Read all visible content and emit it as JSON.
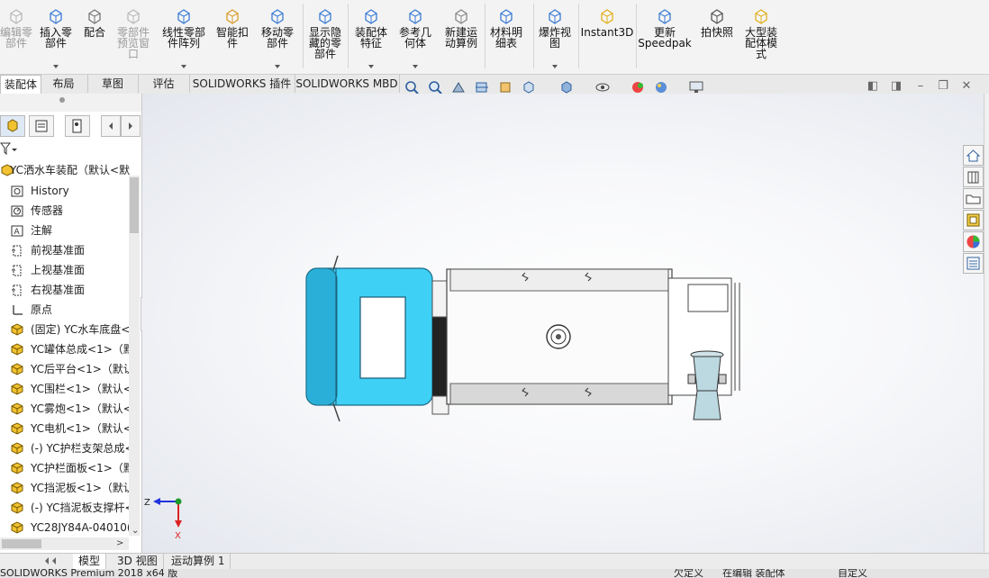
{
  "ribbon": {
    "commands": [
      {
        "id": "edit-component",
        "label": "编辑零\n部件",
        "disabled": true
      },
      {
        "id": "insert-component",
        "label": "插入零\n部件",
        "disabled": false,
        "dropdown": true
      },
      {
        "id": "mate",
        "label": "配合",
        "disabled": false
      },
      {
        "id": "component-preview",
        "label": "零部件\n预览窗\n口",
        "disabled": true
      },
      {
        "id": "linear-pattern",
        "label": "线性零部\n件阵列",
        "disabled": false,
        "dropdown": true
      },
      {
        "id": "smart-fasteners",
        "label": "智能扣\n件",
        "disabled": false
      },
      {
        "id": "move-component",
        "label": "移动零\n部件",
        "disabled": false,
        "dropdown": true
      },
      {
        "id": "show-hidden",
        "label": "显示隐\n藏的零\n部件",
        "disabled": false
      },
      {
        "id": "assembly-features",
        "label": "装配体\n特征",
        "disabled": false,
        "dropdown": true
      },
      {
        "id": "reference-geometry",
        "label": "参考几\n何体",
        "disabled": false,
        "dropdown": true
      },
      {
        "id": "new-motion-study",
        "label": "新建运\n动算例",
        "disabled": false
      },
      {
        "id": "bill-of-materials",
        "label": "材料明\n细表",
        "disabled": false
      },
      {
        "id": "exploded-view",
        "label": "爆炸视\n图",
        "disabled": false,
        "dropdown": true
      },
      {
        "id": "instant3d",
        "label": "Instant3D",
        "disabled": false
      },
      {
        "id": "update-speedpak",
        "label": "更新\nSpeedpak",
        "disabled": false
      },
      {
        "id": "take-snapshot",
        "label": "拍快照",
        "disabled": false
      },
      {
        "id": "large-assembly",
        "label": "大型装\n配体模\n式",
        "disabled": false
      }
    ]
  },
  "tabs": [
    "装配体",
    "布局",
    "草图",
    "评估",
    "SOLIDWORKS 插件",
    "SOLIDWORKS MBD"
  ],
  "tree": {
    "root": "YC洒水车装配（默认<默",
    "items": [
      {
        "label": "History",
        "icon": "history-icon"
      },
      {
        "label": "传感器",
        "icon": "sensor-icon"
      },
      {
        "label": "注解",
        "icon": "annotation-icon"
      },
      {
        "label": "前视基准面",
        "icon": "plane-icon"
      },
      {
        "label": "上视基准面",
        "icon": "plane-icon"
      },
      {
        "label": "右视基准面",
        "icon": "plane-icon"
      },
      {
        "label": "原点",
        "icon": "origin-icon"
      },
      {
        "label": "(固定) YC水车底盘<",
        "icon": "part-icon"
      },
      {
        "label": "YC罐体总成<1>（默",
        "icon": "part-icon"
      },
      {
        "label": "YC后平台<1>（默认",
        "icon": "part-icon"
      },
      {
        "label": "YC围栏<1>（默认<默",
        "icon": "part-icon"
      },
      {
        "label": "YC雾炮<1>（默认<默",
        "icon": "part-icon"
      },
      {
        "label": "YC电机<1>（默认<",
        "icon": "part-icon"
      },
      {
        "label": "(-) YC护栏支架总成<",
        "icon": "part-icon"
      },
      {
        "label": "YC护栏面板<1>（默",
        "icon": "part-icon"
      },
      {
        "label": "YC挡泥板<1>（默认",
        "icon": "part-icon"
      },
      {
        "label": "(-) YC挡泥板支撑杆<",
        "icon": "part-icon"
      },
      {
        "label": "YC28JY84A-04010(",
        "icon": "part-icon"
      }
    ]
  },
  "triad": {
    "z": "Z",
    "x": "X"
  },
  "bottom_tabs": [
    "模型",
    "3D 视图",
    "运动算例 1"
  ],
  "status": {
    "app": "SOLIDWORKS Premium 2018 x64 版",
    "state1": "欠定义",
    "state2": "在编辑 装配体",
    "state3": "自定义"
  },
  "colors": {
    "cab": "#3fd0f5",
    "accent": "#2a6db5"
  }
}
